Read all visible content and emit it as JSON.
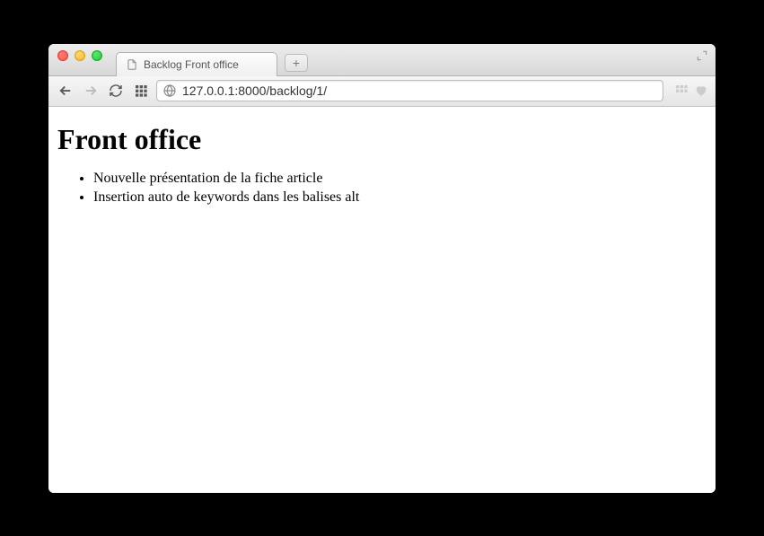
{
  "tab": {
    "title": "Backlog Front office"
  },
  "urlbar": {
    "value": "127.0.0.1:8000/backlog/1/"
  },
  "page": {
    "heading": "Front office",
    "items": [
      "Nouvelle présentation de la fiche article",
      "Insertion auto de keywords dans les balises alt"
    ]
  }
}
